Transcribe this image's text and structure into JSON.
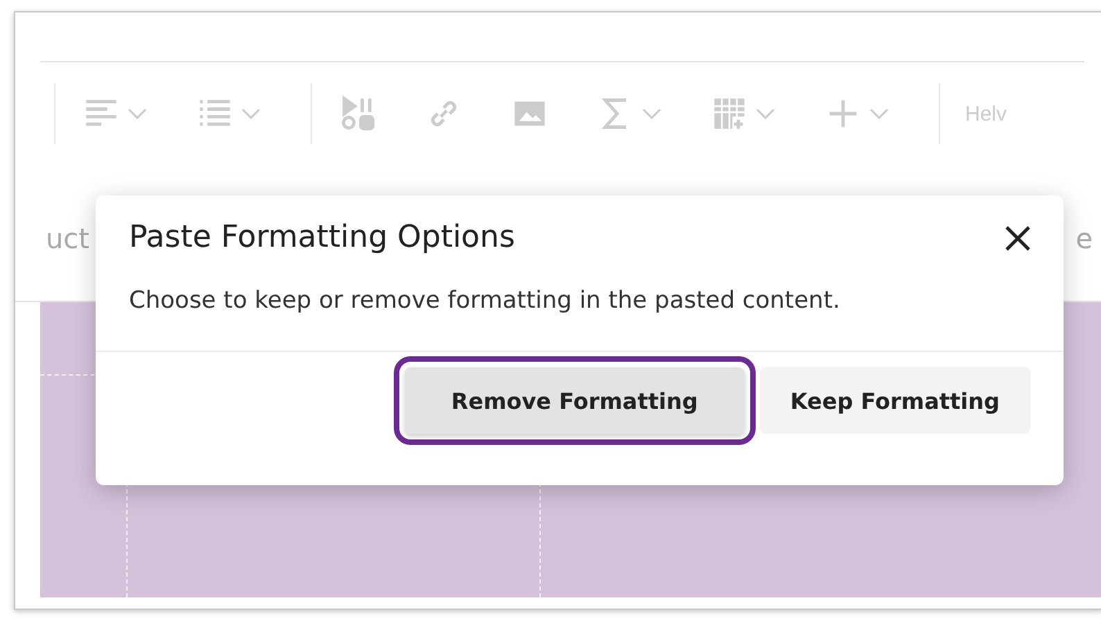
{
  "toolbar": {
    "items": [
      {
        "kind": "align",
        "dropdown": true
      },
      {
        "kind": "list",
        "dropdown": true
      },
      {
        "kind": "media",
        "dropdown": false
      },
      {
        "kind": "link",
        "dropdown": false
      },
      {
        "kind": "image",
        "dropdown": false
      },
      {
        "kind": "sigma",
        "dropdown": true
      },
      {
        "kind": "table",
        "dropdown": true
      },
      {
        "kind": "plus",
        "dropdown": true
      }
    ],
    "font_field": {
      "value": "Helv"
    }
  },
  "tab_row": {
    "column_1": "uct",
    "column_2": "e"
  },
  "dialog": {
    "title": "Paste Formatting Options",
    "message": "Choose to keep or remove formatting in the pasted content.",
    "buttons": [
      {
        "label": "Remove Formatting",
        "selected": true
      },
      {
        "label": "Keep Formatting",
        "selected": false
      }
    ]
  }
}
